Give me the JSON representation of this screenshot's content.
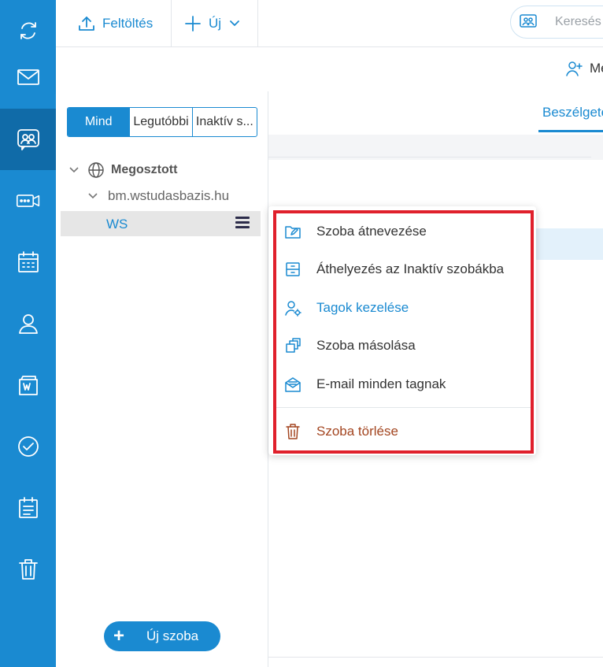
{
  "toolbar": {
    "upload_label": "Feltöltés",
    "new_label": "Új",
    "search_placeholder": "Keresés"
  },
  "subbar": {
    "members_label": "Me"
  },
  "panel": {
    "segments": [
      "Mind",
      "Legutóbbi",
      "Inaktív s..."
    ],
    "tree": {
      "root_label": "Megosztott",
      "domain_label": "bm.wstudasbazis.hu",
      "room_label": "WS"
    },
    "new_room_label": "Új szoba"
  },
  "main": {
    "tab_label": "Beszélgetés"
  },
  "context_menu": {
    "items": [
      {
        "label": "Szoba átnevezése",
        "icon": "folder-edit-icon"
      },
      {
        "label": "Áthelyezés az Inaktív szobákba",
        "icon": "archive-icon"
      },
      {
        "label": "Tagok kezelése",
        "icon": "user-settings-icon"
      },
      {
        "label": "Szoba másolása",
        "icon": "copy-icon"
      },
      {
        "label": "E-mail minden tagnak",
        "icon": "mail-open-icon"
      }
    ],
    "delete_label": "Szoba törlése",
    "highlight_color": "#e0202c"
  },
  "rail": {
    "icons": [
      "sync-icon",
      "mail-icon",
      "rooms-icon",
      "video-meeting-icon",
      "calendar-icon",
      "contacts-icon",
      "files-icon",
      "tasks-icon",
      "notes-icon",
      "trash-icon"
    ],
    "active": "rooms-icon"
  },
  "colors": {
    "accent": "#1a8ad1",
    "rail_active": "#106ba8",
    "danger": "#a34520"
  }
}
